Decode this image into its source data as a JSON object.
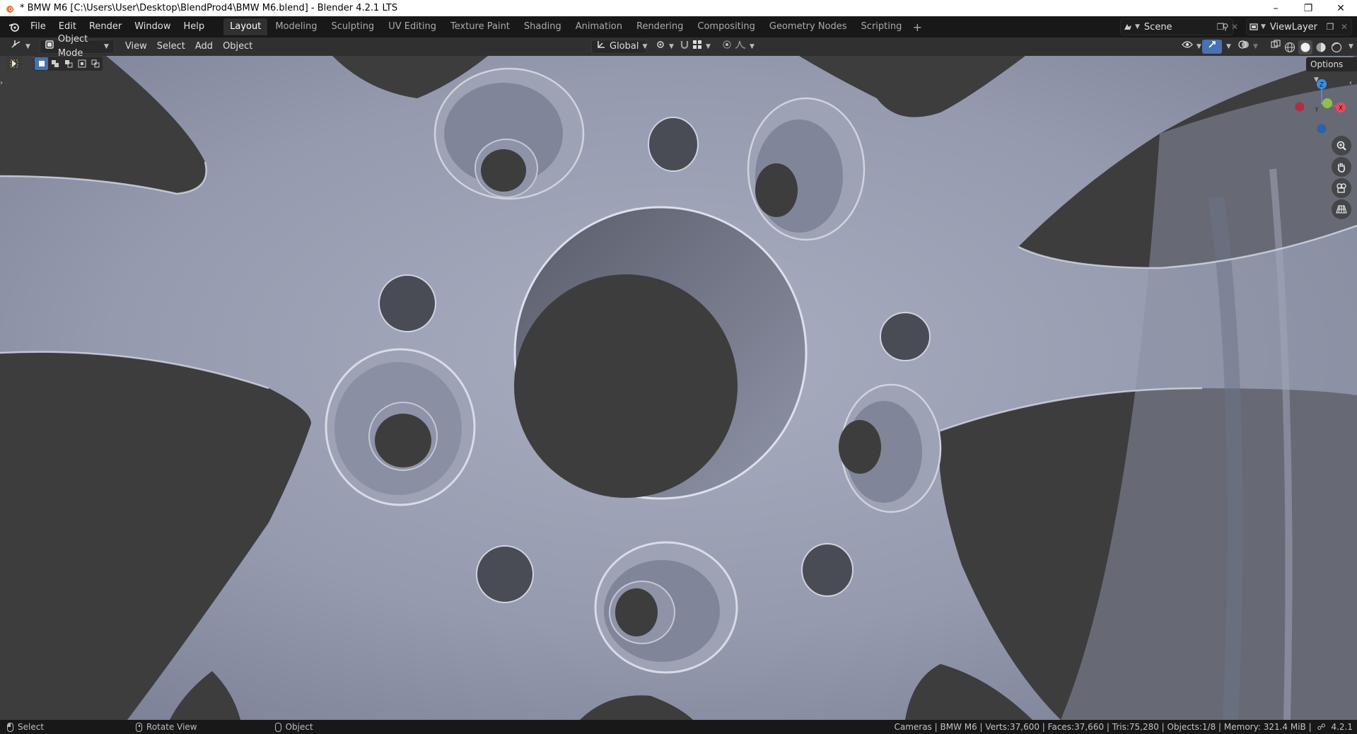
{
  "window": {
    "title": "* BMW M6 [C:\\Users\\User\\Desktop\\BlendProd4\\BMW M6.blend] - Blender 4.2.1 LTS",
    "controls": [
      "minimize-icon",
      "restore-icon",
      "close-icon"
    ]
  },
  "menu": {
    "items": [
      "File",
      "Edit",
      "Render",
      "Window",
      "Help"
    ]
  },
  "workspaces": {
    "tabs": [
      "Layout",
      "Modeling",
      "Sculpting",
      "UV Editing",
      "Texture Paint",
      "Shading",
      "Animation",
      "Rendering",
      "Compositing",
      "Geometry Nodes",
      "Scripting"
    ],
    "active": "Layout",
    "add_label": "+"
  },
  "scene": {
    "name": "Scene"
  },
  "view_layer": {
    "name": "ViewLayer"
  },
  "viewport_header": {
    "mode": "Object Mode",
    "menus": [
      "View",
      "Select",
      "Add",
      "Object"
    ],
    "transform_orientation": "Global",
    "options_label": "Options"
  },
  "gizmo": {
    "z": "Z",
    "y": "Y",
    "x": "X"
  },
  "statusbar": {
    "hints": [
      {
        "icon": "mouse-left-icon",
        "label": "Select"
      },
      {
        "icon": "mouse-middle-icon",
        "label": "Rotate View"
      },
      {
        "icon": "mouse-right-icon",
        "label": "Object"
      }
    ],
    "stats": "Cameras | BMW M6 | Verts:37,600 | Faces:37,660 | Tris:75,280 | Objects:1/8 | Memory: 321.4 MiB |",
    "version": "4.2.1"
  },
  "colors": {
    "accent": "#4772b3",
    "rim": "#9aa0b4",
    "hole": "#3d3d3d",
    "axis_x": "#e84a5f",
    "axis_y": "#8bc34a",
    "axis_z": "#3b8fe8"
  }
}
